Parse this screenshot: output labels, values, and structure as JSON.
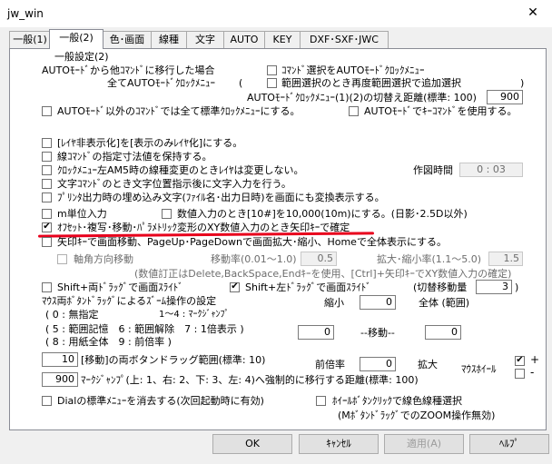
{
  "window": {
    "title": "jw_win",
    "close_icon": "close-icon"
  },
  "tabs": [
    {
      "label": "一般(1)"
    },
    {
      "label": "一般(2)"
    },
    {
      "label": "色･画面"
    },
    {
      "label": "線種"
    },
    {
      "label": "文字"
    },
    {
      "label": "AUTO"
    },
    {
      "label": "KEY"
    },
    {
      "label": "DXF･SXF･JWC"
    }
  ],
  "section_title": "一般設定(2)",
  "auto_mode": {
    "l1": "AUTOﾓｰﾄﾞから他ｺﾏﾝﾄﾞに移行した場合",
    "l2": "全てAUTOﾓｰﾄﾞｸﾛｯｸﾒﾆｭｰ",
    "paren_open": "(",
    "cb_cmd_select": "ｺﾏﾝﾄﾞ選択をAUTOﾓｰﾄﾞｸﾛｯｸﾒﾆｭｰ",
    "cb_range": "範囲選択のとき再度範囲選択で追加選択",
    "paren_close": ")",
    "distance_label": "AUTOﾓｰﾄﾞｸﾛｯｸﾒﾆｭｰ(1)(2)の切替え距離(標準: 100)",
    "distance_value": "900",
    "cb_std_clock": "AUTOﾓｰﾄﾞ以外のｺﾏﾝﾄﾞでは全て標準ｸﾛｯｸﾒﾆｭｰにする。",
    "cb_key_cmd": "AUTOﾓｰﾄﾞでｷｰｺﾏﾝﾄﾞを使用する。"
  },
  "options": [
    {
      "label": "[ﾚｲﾔ非表示化]を[表示のみﾚｲﾔ化]にする。",
      "checked": false
    },
    {
      "label": "線ｺﾏﾝﾄﾞの指定寸法値を保持する。",
      "checked": false
    },
    {
      "label": "ｸﾛｯｸﾒﾆｭｰ左AM5時の線種変更のときﾚｲﾔは変更しない。",
      "checked": false
    },
    {
      "label": "文字ｺﾏﾝﾄﾞのとき文字位置指示後に文字入力を行う。",
      "checked": false
    },
    {
      "label": "ﾌﾟﾘﾝﾀ出力時の埋め込み文字(ﾌｧｲﾙ名･出力日時)を画面にも変換表示する。",
      "checked": false
    }
  ],
  "drawing_time": {
    "label": "作図時間",
    "value": "0 : 03"
  },
  "m_unit": {
    "label": "m単位入力",
    "checked": false
  },
  "num_input": {
    "label": "数値入力のとき[10#]を10,000(10m)にする。(日影･2.5D以外)",
    "checked": false
  },
  "offset_opt": {
    "label": "ｵﾌｾｯﾄ･複写･移動･ﾊﾟﾗﾒﾄﾘｯｸ変形のXY数値入力のとき矢印ｷｰで確定",
    "checked": true
  },
  "arrow_opt": {
    "label": "矢印ｷｰで画面移動、PageUp･PageDownで画面拡大･縮小、Homeで全体表示にする。",
    "checked": false
  },
  "axis_move": {
    "label": "軸角方向移動",
    "move_rate_label": "移動率(0.01～1.0)",
    "move_rate_value": "0.5",
    "zoom_rate_label": "拡大･縮小率(1.1～5.0)",
    "zoom_rate_value": "1.5",
    "note": "(数値訂正はDelete,BackSpace,Endｷｰを使用、[Ctrl]+矢印ｷｰでXY数値入力の確定)"
  },
  "drag": {
    "cb_shift_both": "Shift+両ﾄﾞﾗｯｸﾞで画面ｽﾗｲﾄﾞ",
    "cb_shift_both_checked": false,
    "cb_shift_left": "Shift+左ﾄﾞﾗｯｸﾞで画面ｽﾗｲﾄﾞ",
    "cb_shift_left_checked": true,
    "switch_label": "(切替移動量",
    "switch_value": "3",
    "switch_close": ")"
  },
  "zoom_ops": {
    "title": "ﾏｳｽ両ﾎﾞﾀﾝﾄﾞﾗｯｸﾞによるｽﾞｰﾑ操作の設定",
    "line1": "( 0 : 無指定",
    "line1b": "1～4 : ﾏｰｸｼﾞｬﾝﾌﾟ",
    "line2": "( 5 : 範囲記憶　6 : 範囲解除　7 : 1倍表示 )",
    "line3": "( 8 : 用紙全体　9 : 前倍率 )",
    "shrink_label": "縮小",
    "shrink_value": "0",
    "whole_label": "全体 (範囲)",
    "left_value": "0",
    "move_label": "--移動--",
    "right_value": "0",
    "prev_label": "前倍率",
    "prev_value": "0",
    "enlarge_label": "拡大",
    "wheel_label": "ﾏｳｽﾎｲｰﾙ",
    "wheel_plus": "+",
    "wheel_minus": "-",
    "wheel_plus_checked": true,
    "wheel_minus_checked": false
  },
  "both_drag": {
    "value": "10",
    "label": "[移動]の両ボタンドラッグ範囲(標準: 10)"
  },
  "mark_jump": {
    "value": "900",
    "label": "ﾏｰｸｼﾞｬﾝﾌﾟ(上: 1、右: 2、下: 3、左: 4)へ強制的に移行する距離(標準: 100)"
  },
  "dial": {
    "label": "Dialの標準ﾒﾆｭｰを消去する(次回起動時に有効)",
    "checked": false
  },
  "wheel_btn": {
    "label": "ﾎｲｰﾙﾎﾞﾀﾝｸﾘｯｸで線色線種選択",
    "sub": "(MﾎﾞﾀﾝﾄﾞﾗｯｸﾞでのZOOM操作無効)",
    "checked": false
  },
  "buttons": {
    "ok": "OK",
    "cancel": "ｷｬﾝｾﾙ",
    "apply": "適用(A)",
    "help": "ﾍﾙﾌﾟ"
  }
}
